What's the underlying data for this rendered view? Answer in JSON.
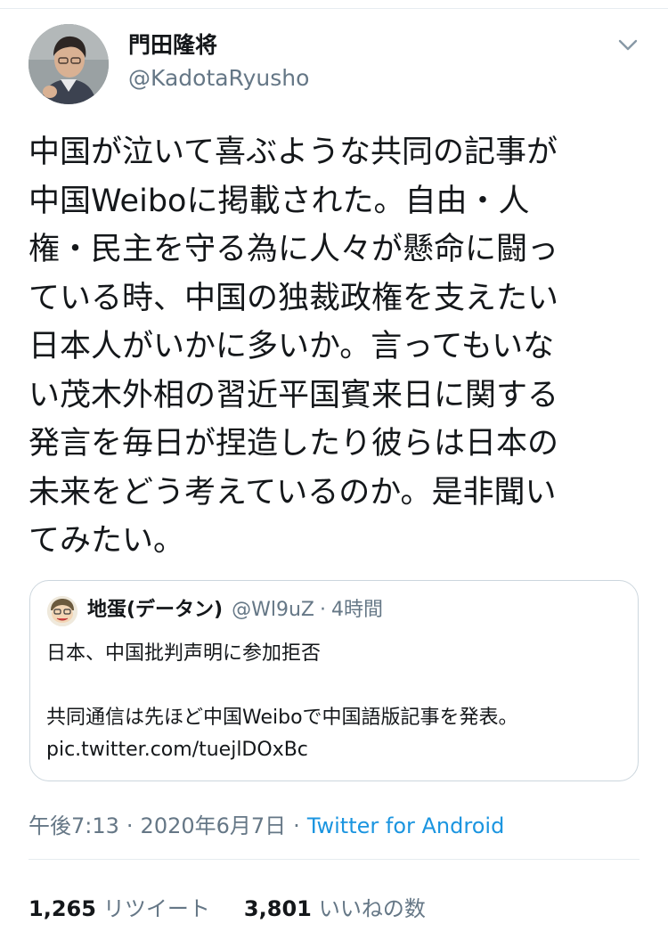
{
  "author": {
    "name": "門田隆将",
    "handle": "@KadotaRyusho"
  },
  "icons": {
    "more": "chevron-down-icon"
  },
  "tweet": {
    "lines": [
      "中国が泣いて喜ぶような共同の記事が",
      "中国Weiboに掲載された。自由・人",
      "権・民主を守る為に人々が懸命に闘っ",
      "ている時、中国の独裁政権を支えたい",
      "日本人がいかに多いか。言ってもいな",
      "い茂木外相の習近平国賓来日に関する",
      "発言を毎日が捏造したり彼らは日本の",
      "未来をどう考えているのか。是非聞い",
      "てみたい。"
    ]
  },
  "quote": {
    "name": "地蛋(データン)",
    "handle": "@Wl9uZ",
    "separator": "·",
    "time": "4時間",
    "line1": "日本、中国批判声明に参加拒否",
    "line2": "共同通信は先ほど中国Weiboで中国語版記事を発表。",
    "line3": "pic.twitter.com/tuejlDOxBc"
  },
  "meta": {
    "time": "午後7:13",
    "separator": "·",
    "date": "2020年6月7日",
    "source": "Twitter for Android"
  },
  "stats": {
    "retweets_count": "1,265",
    "retweets_label": "リツイート",
    "likes_count": "3,801",
    "likes_label": "いいねの数"
  },
  "colors": {
    "text": "#14171a",
    "secondary": "#657786",
    "link": "#1b95e0",
    "border": "#ccd6dd"
  }
}
